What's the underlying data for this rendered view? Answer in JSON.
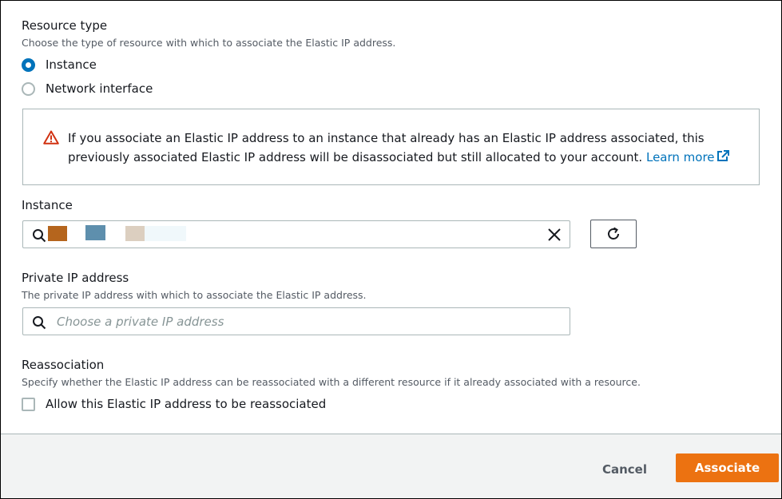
{
  "resource_type": {
    "title": "Resource type",
    "description": "Choose the type of resource with which to associate the Elastic IP address.",
    "options": [
      {
        "label": "Instance",
        "selected": true
      },
      {
        "label": "Network interface",
        "selected": false
      }
    ]
  },
  "alert": {
    "icon": "warning-triangle-icon",
    "text": "If you associate an Elastic IP address to an instance that already has an Elastic IP address associated, this previously associated Elastic IP address will be disassociated but still allocated to your account.",
    "link_label": "Learn more",
    "link_icon": "external-link-icon"
  },
  "instance": {
    "title": "Instance",
    "value_redacted": true,
    "clear_icon": "close-icon",
    "refresh_icon": "refresh-icon"
  },
  "private_ip": {
    "title": "Private IP address",
    "description": "The private IP address with which to associate the Elastic IP address.",
    "placeholder": "Choose a private IP address"
  },
  "reassociation": {
    "title": "Reassociation",
    "description": "Specify whether the Elastic IP address can be reassociated with a different resource if it already associated with a resource.",
    "checkbox_label": "Allow this Elastic IP address to be reassociated",
    "checked": false
  },
  "footer": {
    "cancel_label": "Cancel",
    "associate_label": "Associate"
  },
  "colors": {
    "accent": "#0073bb",
    "primary_button": "#ec7211",
    "warning": "#d13212"
  }
}
